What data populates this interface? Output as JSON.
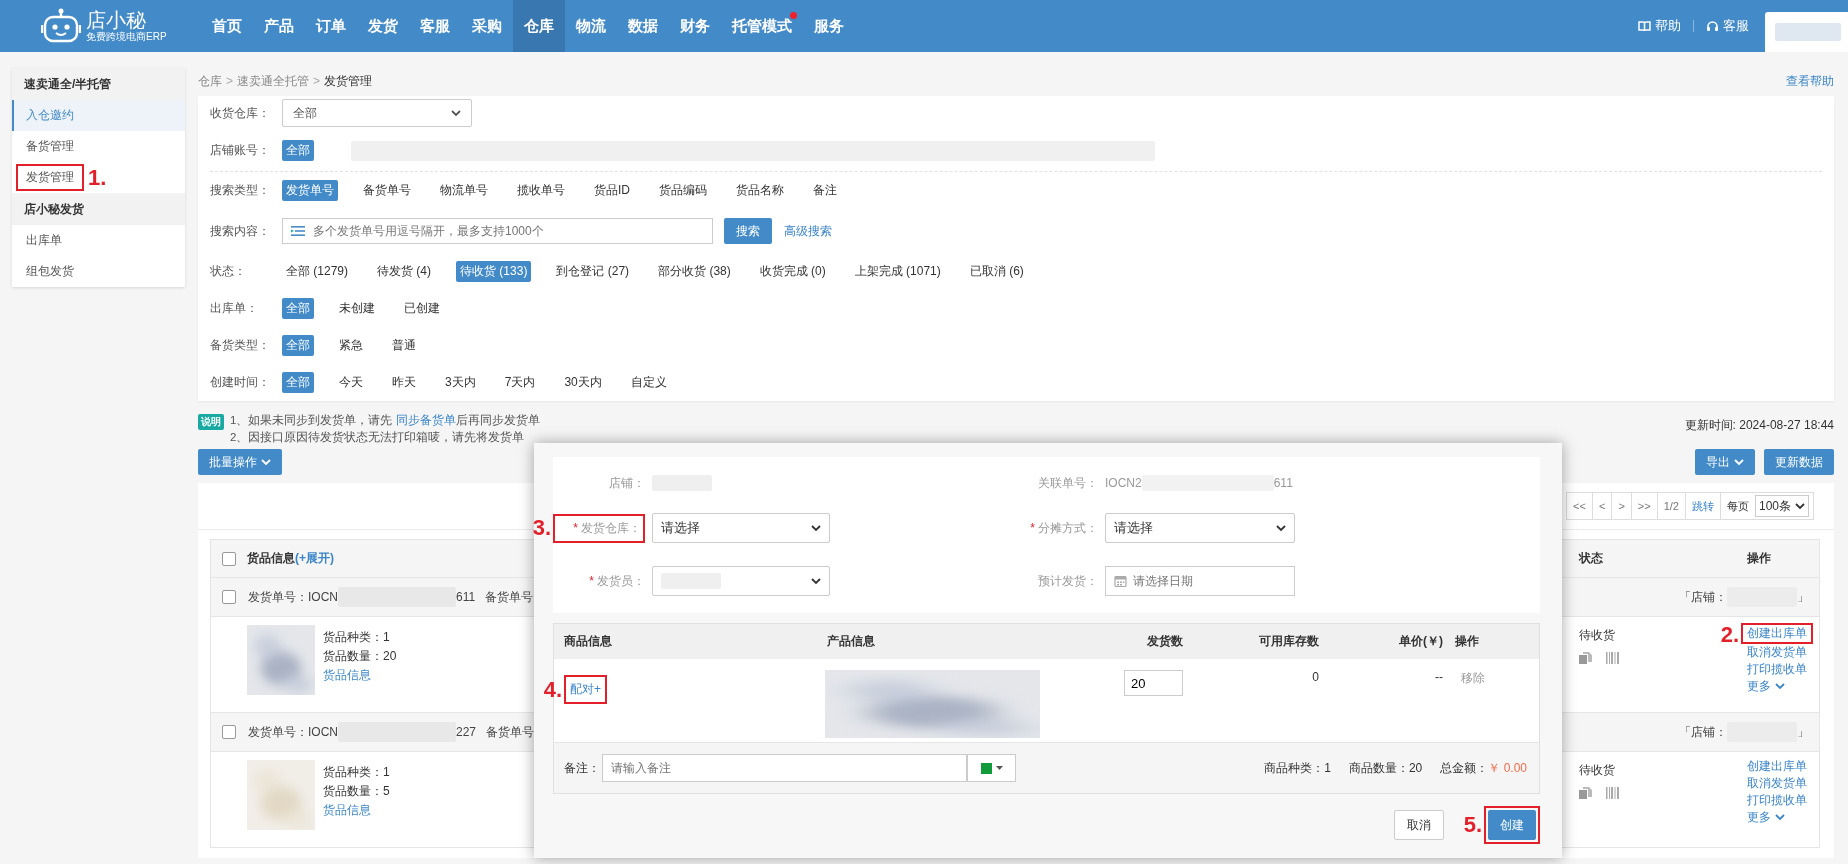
{
  "top_bar": {
    "logo": {
      "name": "店小秘",
      "tagline": "免费跨境电商ERP"
    },
    "nav": [
      {
        "label": "首页",
        "selected": false,
        "dot": false
      },
      {
        "label": "产品",
        "selected": false,
        "dot": false
      },
      {
        "label": "订单",
        "selected": false,
        "dot": false
      },
      {
        "label": "发货",
        "selected": false,
        "dot": false
      },
      {
        "label": "客服",
        "selected": false,
        "dot": false
      },
      {
        "label": "采购",
        "selected": false,
        "dot": false
      },
      {
        "label": "仓库",
        "selected": true,
        "dot": false
      },
      {
        "label": "物流",
        "selected": false,
        "dot": false
      },
      {
        "label": "数据",
        "selected": false,
        "dot": false
      },
      {
        "label": "财务",
        "selected": false,
        "dot": false
      },
      {
        "label": "托管模式",
        "selected": false,
        "dot": true
      },
      {
        "label": "服务",
        "selected": false,
        "dot": false
      }
    ],
    "links": [
      {
        "label": "帮助",
        "kind": "book"
      },
      {
        "label": "客服",
        "kind": "headset"
      }
    ]
  },
  "sidebar": {
    "groups": [
      {
        "title": "速卖通全/半托管",
        "items": [
          {
            "label": "入仓邀约",
            "selected": true
          },
          {
            "label": "备货管理",
            "selected": false
          },
          {
            "label": "发货管理",
            "selected": false,
            "annotation": "1."
          }
        ]
      },
      {
        "title": "店小秘发货",
        "items": [
          {
            "label": "出库单",
            "selected": false
          },
          {
            "label": "组包发货",
            "selected": false
          }
        ]
      }
    ]
  },
  "breadcrumb": {
    "items": [
      "仓库",
      "速卖通全托管",
      "发货管理"
    ],
    "separator": ">",
    "help": "查看帮助"
  },
  "filters": {
    "rows": [
      {
        "kind": "select",
        "label": "收货仓库：",
        "value": "全部"
      },
      {
        "kind": "account",
        "label": "店铺账号：",
        "chip": "全部"
      },
      {
        "kind": "options",
        "label": "搜索类型：",
        "options": [
          {
            "label": "发货单号",
            "selected": true
          },
          {
            "label": "备货单号",
            "selected": false
          },
          {
            "label": "物流单号",
            "selected": false
          },
          {
            "label": "揽收单号",
            "selected": false
          },
          {
            "label": "货品ID",
            "selected": false
          },
          {
            "label": "货品编码",
            "selected": false
          },
          {
            "label": "货品名称",
            "selected": false
          },
          {
            "label": "备注",
            "selected": false
          }
        ]
      },
      {
        "kind": "search",
        "label": "搜索内容：",
        "placeholder": "多个发货单号用逗号隔开，最多支持1000个",
        "button": "搜索",
        "advanced": "高级搜索"
      },
      {
        "kind": "options",
        "label": "状态：",
        "options": [
          {
            "label": "全部 (1279)",
            "selected": false
          },
          {
            "label": "待发货 (4)",
            "selected": false
          },
          {
            "label": "待收货 (133)",
            "selected": true
          },
          {
            "label": "到仓登记 (27)",
            "selected": false
          },
          {
            "label": "部分收货 (38)",
            "selected": false
          },
          {
            "label": "收货完成 (0)",
            "selected": false
          },
          {
            "label": "上架完成 (1071)",
            "selected": false
          },
          {
            "label": "已取消 (6)",
            "selected": false
          }
        ]
      },
      {
        "kind": "options",
        "label": "出库单：",
        "options": [
          {
            "label": "全部",
            "selected": true
          },
          {
            "label": "未创建",
            "selected": false
          },
          {
            "label": "已创建",
            "selected": false
          }
        ]
      },
      {
        "kind": "options",
        "label": "备货类型：",
        "options": [
          {
            "label": "全部",
            "selected": true
          },
          {
            "label": "紧急",
            "selected": false
          },
          {
            "label": "普通",
            "selected": false
          }
        ]
      },
      {
        "kind": "options",
        "label": "创建时间：",
        "options": [
          {
            "label": "全部",
            "selected": true
          },
          {
            "label": "今天",
            "selected": false
          },
          {
            "label": "昨天",
            "selected": false
          },
          {
            "label": "3天内",
            "selected": false
          },
          {
            "label": "7天内",
            "selected": false
          },
          {
            "label": "30天内",
            "selected": false
          },
          {
            "label": "自定义",
            "selected": false
          }
        ]
      }
    ]
  },
  "notice": {
    "badge": "说明",
    "lines": [
      {
        "text": "1、如果未同步到发货单，请先 ",
        "link": "同步备货单",
        "after": "后再同步发货单"
      },
      {
        "text": "2、因接口原因待发货状态无法打印箱唛，请先将发货单"
      }
    ],
    "update_time": "更新时间: 2024-08-27 18:44"
  },
  "actions": {
    "batch": "批量操作",
    "export": "导出",
    "refresh": "更新数据"
  },
  "pagination": {
    "buttons": [
      "<<",
      "<",
      ">",
      ">>"
    ],
    "page": "1/2",
    "jump": "跳转",
    "per_page_label": "每页",
    "per_page": "100条"
  },
  "table": {
    "header": {
      "checked": false,
      "goods": "货品信息",
      "expand": "(+展开)",
      "status": "状态",
      "actions": "操作"
    },
    "orders": [
      {
        "checked": false,
        "order_start": "发货单号：IOCN",
        "order_end": "611",
        "stock_label": "备货单号",
        "shop_start": "「店铺：",
        "shop_end": "」",
        "kinds": "货品种类：1",
        "qty": "货品数量：20",
        "goods_link": "货品信息",
        "status": "待收货",
        "links": [
          {
            "label": "创建出库单",
            "annotation": "2."
          },
          {
            "label": "取消发货单"
          },
          {
            "label": "打印揽收单"
          },
          {
            "label": "更多"
          }
        ]
      },
      {
        "checked": false,
        "order_start": "发货单号：IOCN",
        "order_end": "227",
        "stock_label": "备货单号",
        "shop_start": "「店铺：",
        "shop_end": "」",
        "kinds": "货品种类：1",
        "qty": "货品数量：5",
        "goods_link": "货品信息",
        "status": "待收货",
        "links": [
          {
            "label": "创建出库单"
          },
          {
            "label": "取消发货单"
          },
          {
            "label": "打印揽收单"
          },
          {
            "label": "更多"
          }
        ]
      }
    ]
  },
  "modal": {
    "fields": [
      {
        "kind": "hidden",
        "label": "店铺："
      },
      {
        "kind": "text",
        "label": "关联单号：",
        "value_start": "IOCN2",
        "value_end": "611"
      },
      {
        "kind": "select",
        "label": "发货仓库：",
        "required_mark": "*",
        "value": "请选择",
        "annotation": "3."
      },
      {
        "kind": "select",
        "label": "分摊方式：",
        "required_mark": "*",
        "value": "请选择"
      },
      {
        "kind": "select_hidden",
        "label": "发货员：",
        "required_mark": "*"
      },
      {
        "kind": "date",
        "label": "预计发货：",
        "placeholder": "请选择日期"
      }
    ],
    "columns": [
      "商品信息",
      "产品信息",
      "发货数",
      "可用库存数",
      "单价(￥)",
      "操作"
    ],
    "row": {
      "pair": "配对+",
      "pair_annotation": "4.",
      "qty": "20",
      "stock": "0",
      "price": "--",
      "remove": "移除"
    },
    "remark": {
      "label": "备注：",
      "placeholder": "请输入备注",
      "color": "#119a3a"
    },
    "summary": [
      {
        "text": "商品种类：1",
        "kind": "plain"
      },
      {
        "text": "商品数量：20",
        "kind": "plain"
      },
      {
        "label": "总金额：",
        "text": "￥ 0.00",
        "kind": "money"
      }
    ],
    "buttons": [
      {
        "label": "取消",
        "kind": "default"
      },
      {
        "label": "创建",
        "kind": "primary",
        "annotation": "5."
      }
    ]
  }
}
